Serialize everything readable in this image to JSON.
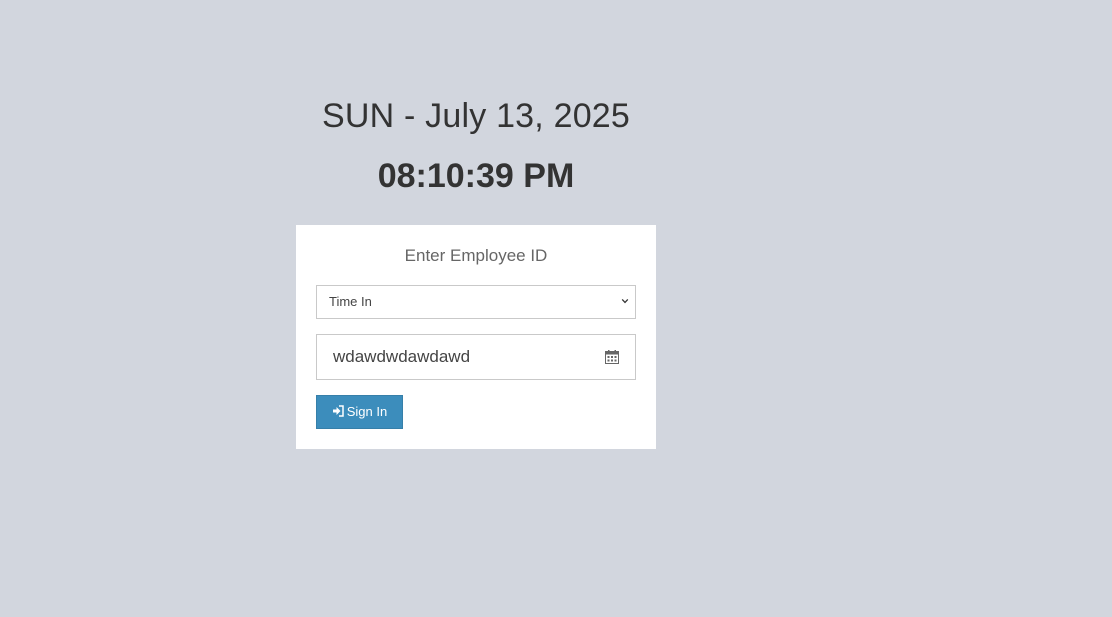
{
  "clock": {
    "date": "SUN - July 13, 2025",
    "time": "08:10:39 PM"
  },
  "form": {
    "title": "Enter Employee ID",
    "status_select": {
      "selected": "Time In"
    },
    "employee_id": {
      "value": "wdawdwdawdawd"
    },
    "submit_label": "Sign In"
  },
  "icons": {
    "select": "chevron-down-icon",
    "input": "calendar-icon",
    "submit": "sign-in-icon"
  },
  "colors": {
    "background": "#d2d6de",
    "primary_button": "#3c8dbc"
  }
}
